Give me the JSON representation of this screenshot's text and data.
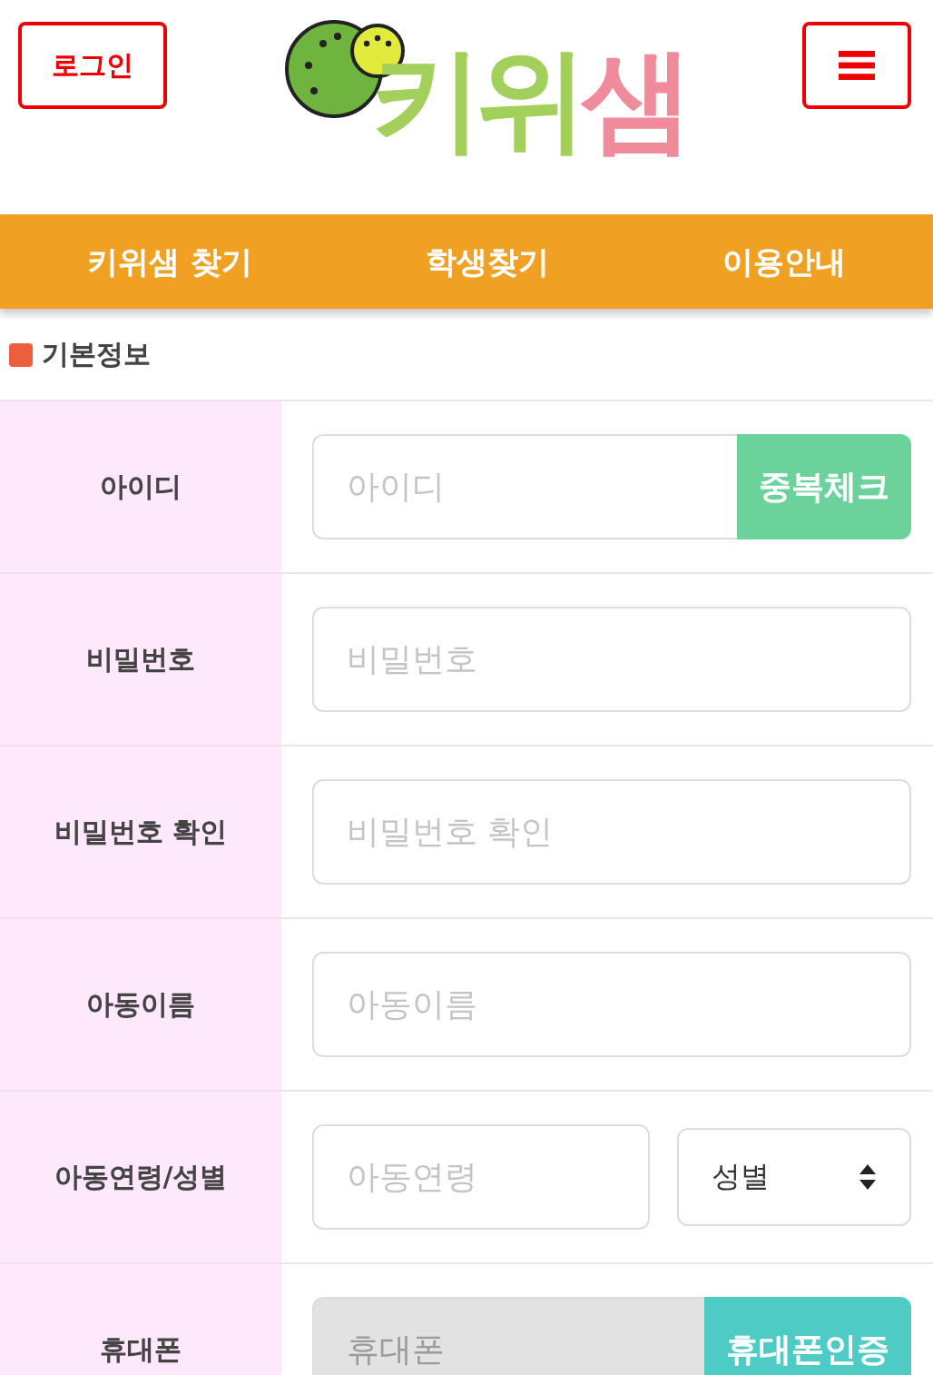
{
  "header": {
    "login_button": "로그인",
    "logo": [
      {
        "text": "키위",
        "color": "#a3cf5b"
      },
      {
        "text": "샘",
        "color": "#ef8b9b"
      }
    ]
  },
  "nav": [
    "키위샘 찾기",
    "학생찾기",
    "이용안내"
  ],
  "section_title": "기본정보",
  "rows": [
    {
      "kind": "input_button",
      "label": "아이디",
      "placeholder": "아이디",
      "disabled": false,
      "button": "중복체크",
      "color": "#6bd29c"
    },
    {
      "kind": "input",
      "label": "비밀번호",
      "placeholder": "비밀번호",
      "disabled": false
    },
    {
      "kind": "input",
      "label": "비밀번호 확인",
      "placeholder": "비밀번호 확인",
      "disabled": false
    },
    {
      "kind": "input",
      "label": "아동이름",
      "placeholder": "아동이름",
      "disabled": false
    },
    {
      "kind": "input_select",
      "label": "아동연령/성별",
      "placeholder": "아동연령",
      "disabled": false,
      "select": "성별"
    },
    {
      "kind": "input_button",
      "label": "휴대폰",
      "placeholder": "휴대폰",
      "disabled": true,
      "button": "휴대폰인증",
      "color": "#4fcbc5"
    }
  ]
}
